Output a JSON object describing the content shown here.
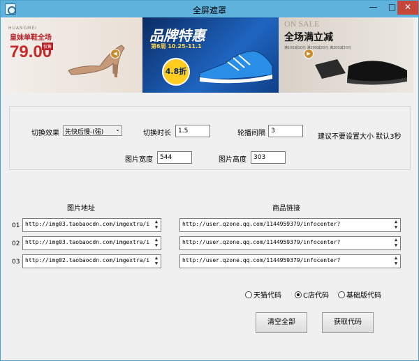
{
  "window": {
    "title": "全屏遮罩",
    "accent": "#5fb2dc"
  },
  "titlebar": {
    "minimize": "—",
    "maximize": "□",
    "close": "✕"
  },
  "banner": {
    "panel1": {
      "brand": "HUANGMEI",
      "slogan": "皇妹单鞋全场",
      "price": "79.00",
      "tag": "仅售"
    },
    "panel2": {
      "headline": "品牌特惠",
      "sub": "第6周 10.25-11.1",
      "badge": "4.8折"
    },
    "panel3": {
      "sale": "ON SALE",
      "headline": "全场满立减",
      "coupon": "满100减10元 满200减20元 满300减30元"
    }
  },
  "settings": {
    "effect_label": "切换效果",
    "effect_value": "先快后慢-(强)",
    "duration_label": "切换时长",
    "duration_value": "1.5",
    "interval_label": "轮播间隔",
    "interval_value": "3",
    "hint": "建议不要设置大小 默认3秒",
    "width_label": "图片宽度",
    "width_value": "544",
    "height_label": "图片高度",
    "height_value": "303"
  },
  "table": {
    "image_header": "图片地址",
    "link_header": "商品链接",
    "rows": [
      {
        "num": "01",
        "image": "http://img03.taobaocdn.com/imgextra/i",
        "link": "http://user.qzone.qq.com/1144959379/infocenter?"
      },
      {
        "num": "02",
        "image": "http://img03.taobaocdn.com/imgextra/i",
        "link": "http://user.qzone.qq.com/1144959379/infocenter?"
      },
      {
        "num": "03",
        "image": "http://img02.taobaocdn.com/imgextra/i",
        "link": "http://user.qzone.qq.com/1144959379/infocenter?"
      }
    ]
  },
  "options": {
    "tmall": "天猫代码",
    "cshop": "C店代码",
    "basic": "基础版代码",
    "selected": "cshop"
  },
  "actions": {
    "clear": "清空全部",
    "get": "获取代码"
  }
}
